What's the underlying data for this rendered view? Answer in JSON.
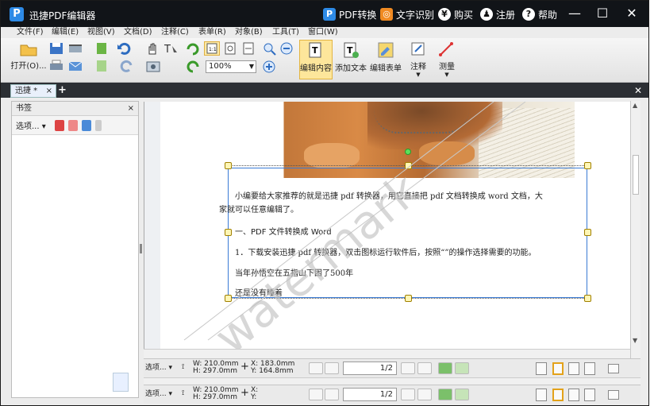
{
  "titlebar": {
    "app_title": "迅捷PDF编辑器",
    "logo_letter": "P",
    "pdf_convert": "PDF转换",
    "ocr": "文字识别",
    "buy": "购买",
    "register": "注册",
    "help": "帮助",
    "minimize": "—",
    "maximize": "☐",
    "close": "✕"
  },
  "menubar": {
    "items": [
      "文件(F)",
      "编辑(E)",
      "视图(V)",
      "文档(D)",
      "注释(C)",
      "表单(R)",
      "对象(B)",
      "工具(T)",
      "窗口(W)"
    ]
  },
  "toolbar": {
    "open_label": "打开(O)...",
    "zoom_value": "100%",
    "edit_content": "编辑内容",
    "add_text": "添加文本",
    "edit_form": "编辑表单",
    "annotate": "注释",
    "measure": "测量"
  },
  "tabs": {
    "active_tab": "迅捷 *",
    "tab_close": "×",
    "add_tab": "+",
    "close_all": "✕"
  },
  "sidebar": {
    "title": "书签",
    "close": "×",
    "options": "选项...",
    "options_arrow": "▾"
  },
  "document": {
    "para1_line1": "小编要给大家推荐的就是迅捷 pdf 转换器，用它直接把 pdf 文档转换成 word 文档，大",
    "para1_line2": "家就可以任意编辑了。",
    "heading1": "一、PDF 文件转换成 Word",
    "step1": "1．下载安装迅捷 pdf 转换器，双击图标运行软件后，按照“”的操作选择需要的功能。",
    "line3": "当年孙悟空在五指山下困了500年",
    "line4": "还是没有睡着",
    "watermark_text": "watermark"
  },
  "statusbar1": {
    "options": "选项...",
    "width": "W: 210.0mm",
    "height": "H: 297.0mm",
    "x": "X: 183.0mm",
    "y": "Y: 164.8mm",
    "page": "1/2"
  },
  "statusbar2": {
    "options": "选项...",
    "width": "W: 210.0mm",
    "height": "H: 297.0mm",
    "x": "X:",
    "y": "Y:",
    "page": "1/2"
  },
  "colors": {
    "titlebar_bg": "#111418",
    "accent": "#2d8ae6",
    "selection_border": "#3a7bd5",
    "handle_fill": "#fff6b5"
  }
}
